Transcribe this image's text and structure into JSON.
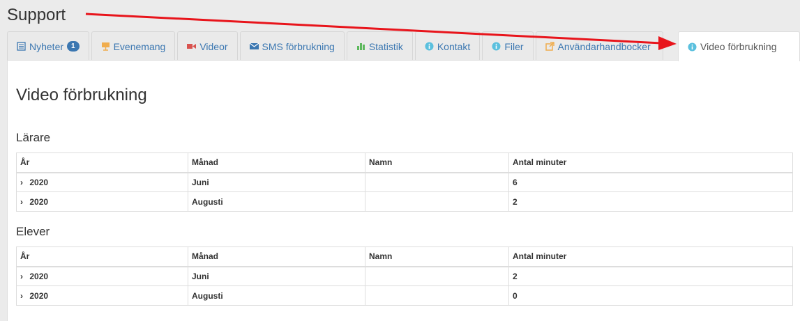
{
  "page": {
    "title": "Support"
  },
  "tabs": [
    {
      "label": "Nyheter",
      "icon": "list-icon",
      "badge": "1"
    },
    {
      "label": "Evenemang",
      "icon": "easel-icon"
    },
    {
      "label": "Videor",
      "icon": "video-camera-icon"
    },
    {
      "label": "SMS förbrukning",
      "icon": "envelope-icon"
    },
    {
      "label": "Statistik",
      "icon": "bar-chart-icon"
    },
    {
      "label": "Kontakt",
      "icon": "info-circle-icon"
    },
    {
      "label": "Filer",
      "icon": "info-circle-icon"
    },
    {
      "label": "Användarhandbocker",
      "icon": "external-link-icon"
    },
    {
      "label": "Video förbrukning",
      "icon": "info-circle-icon",
      "active": true
    }
  ],
  "main": {
    "heading": "Video förbrukning",
    "columns": [
      "År",
      "Månad",
      "Namn",
      "Antal minuter"
    ],
    "sections": [
      {
        "title": "Lärare",
        "rows": [
          {
            "year": "2020",
            "month": "Juni",
            "name": "",
            "minutes": "6"
          },
          {
            "year": "2020",
            "month": "Augusti",
            "name": "",
            "minutes": "2"
          }
        ]
      },
      {
        "title": "Elever",
        "rows": [
          {
            "year": "2020",
            "month": "Juni",
            "name": "",
            "minutes": "2"
          },
          {
            "year": "2020",
            "month": "Augusti",
            "name": "",
            "minutes": "0"
          }
        ]
      }
    ]
  },
  "colors": {
    "link": "#3b77b1",
    "annotation_arrow": "#e8141b"
  }
}
